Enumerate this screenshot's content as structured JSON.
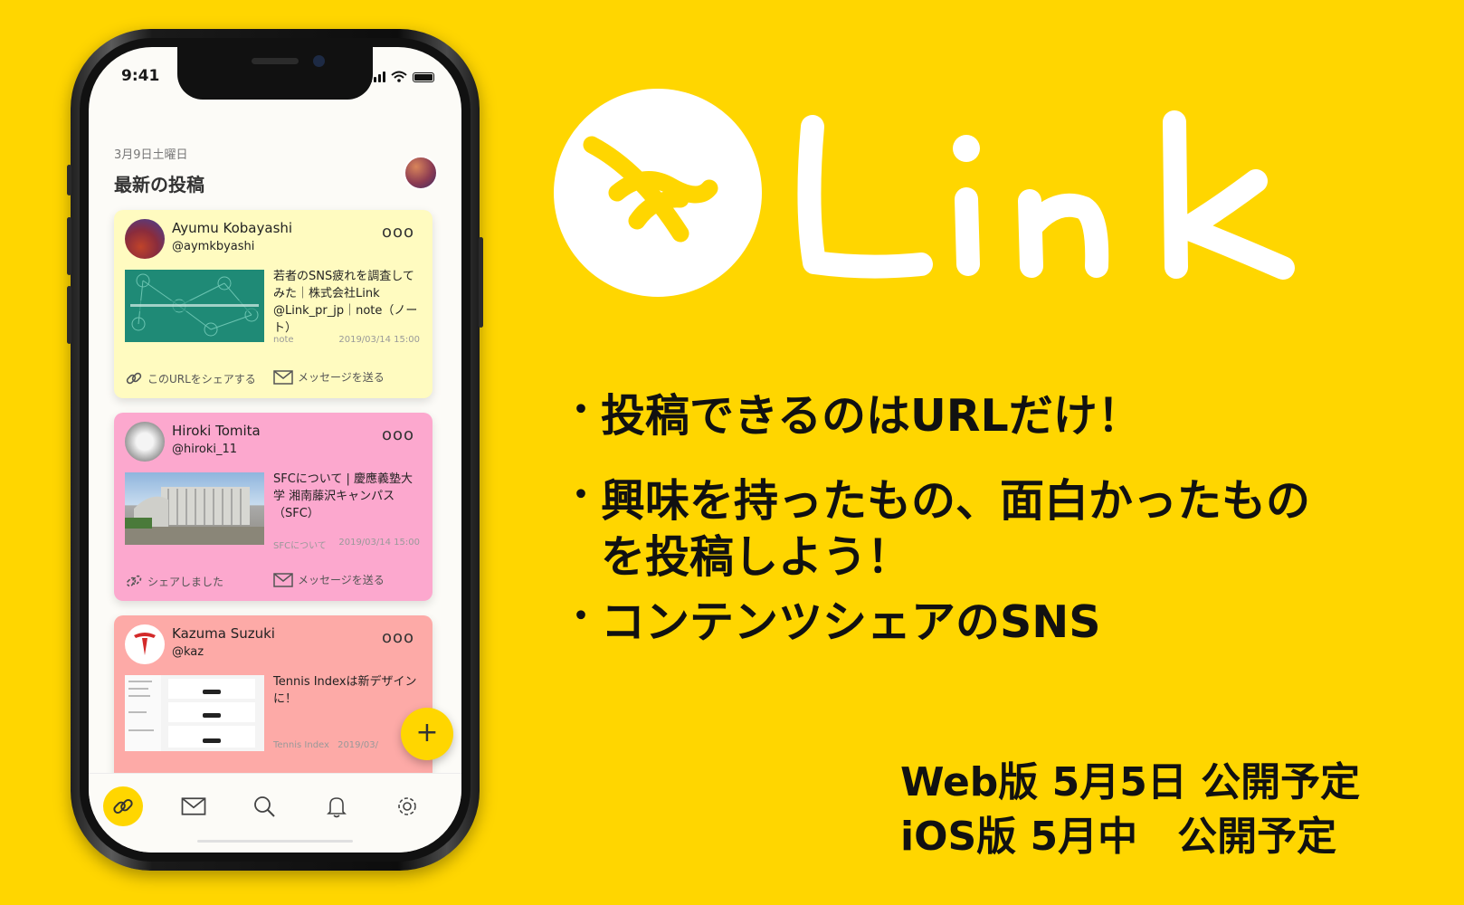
{
  "app": {
    "name": "Link"
  },
  "status_bar": {
    "time": "9:41"
  },
  "feed": {
    "date": "3月9日土曜日",
    "title": "最新の投稿",
    "posts": [
      {
        "user_name": "Ayumu Kobayashi",
        "user_handle": "@aymkbyashi",
        "more": "ooo",
        "title": "若者のSNS疲れを調査してみた｜株式会社Link @Link_pr_jp｜note（ノート）",
        "source": "note",
        "date": "2019/03/14 15:00",
        "share_label": "このURLをシェアする",
        "message_label": "メッセージを送る",
        "card_color": "#FFFBC0"
      },
      {
        "user_name": "Hiroki Tomita",
        "user_handle": "@hiroki_11",
        "more": "ooo",
        "title": "SFCについて | 慶應義塾大学 湘南藤沢キャンパス（SFC）",
        "source": "SFCについて",
        "date": "2019/03/14 15:00",
        "share_label": "シェアしました",
        "message_label": "メッセージを送る",
        "card_color": "#FCA8CE"
      },
      {
        "user_name": "Kazuma Suzuki",
        "user_handle": "@kaz",
        "more": "ooo",
        "title": "Tennis Indexは新デザインに！",
        "source": "Tennis Index",
        "date": "2019/03/",
        "card_color": "#FDAAA7"
      }
    ],
    "fab_label": "+"
  },
  "tabs": [
    "link-icon",
    "mail-icon",
    "search-icon",
    "bell-icon",
    "gear-icon"
  ],
  "promo": {
    "bullets": [
      "投稿できるのはURLだけ！",
      "興味を持ったもの、面白かったもの",
      "を投稿しよう！",
      "コンテンツシェアのSNS"
    ],
    "bullet_mark": "・",
    "release_web": "Web版 5月5日 公開予定",
    "release_ios": "iOS版 5月中　公開予定"
  },
  "colors": {
    "background": "#FFD600",
    "accent": "#FFD600"
  }
}
